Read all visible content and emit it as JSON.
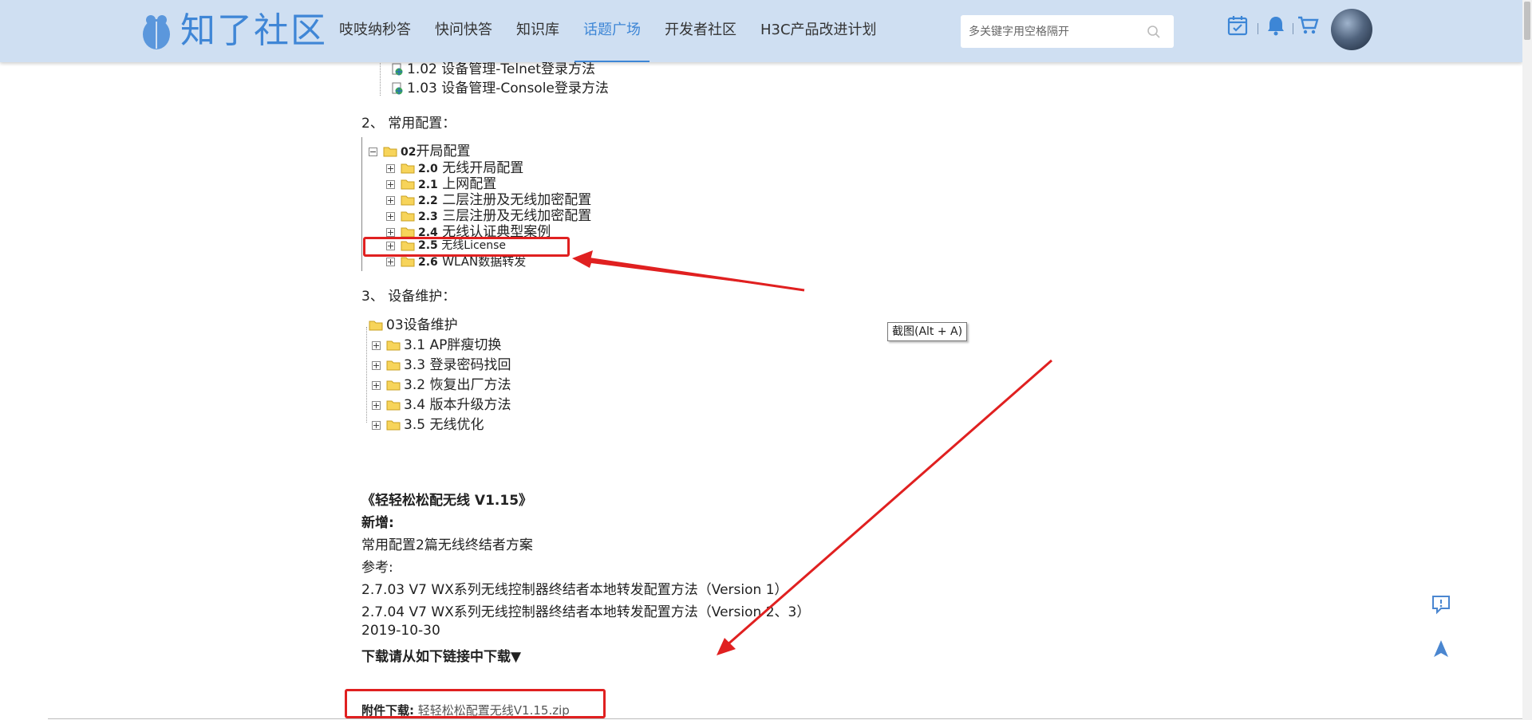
{
  "header": {
    "logo_text": "知了社区",
    "nav": [
      {
        "label": "吱吱纳秒答",
        "active": false
      },
      {
        "label": "快问快答",
        "active": false
      },
      {
        "label": "知识库",
        "active": false
      },
      {
        "label": "话题广场",
        "active": true
      },
      {
        "label": "开发者社区",
        "active": false
      },
      {
        "label": "H3C产品改进计划",
        "active": false
      }
    ],
    "search_placeholder": "多关键字用空格隔开",
    "icons": [
      "calendar-check-icon",
      "bell-icon",
      "cart-icon"
    ]
  },
  "tree1": [
    {
      "num": "1.02",
      "label": "设备管理-Telnet登录方法"
    },
    {
      "num": "1.03",
      "label": "设备管理-Console登录方法"
    }
  ],
  "section2": {
    "heading": "2、 常用配置：",
    "root": {
      "num": "02",
      "label": "开局配置"
    },
    "items": [
      {
        "num": "2.0",
        "label": "无线开局配置"
      },
      {
        "num": "2.1",
        "label": "上网配置"
      },
      {
        "num": "2.2",
        "label": "二层注册及无线加密配置"
      },
      {
        "num": "2.3",
        "label": "三层注册及无线加密配置"
      },
      {
        "num": "2.4",
        "label": "无线认证典型案例"
      },
      {
        "num": "2.5",
        "label": "无线License"
      },
      {
        "num": "2.6",
        "label": "WLAN数据转发"
      }
    ]
  },
  "section3": {
    "heading": "3、 设备维护：",
    "root": {
      "label": "03设备维护"
    },
    "items": [
      {
        "label": "3.1 AP胖瘦切换"
      },
      {
        "label": "3.3 登录密码找回"
      },
      {
        "label": "3.2 恢复出厂方法"
      },
      {
        "label": "3.4 版本升级方法"
      },
      {
        "label": "3.5 无线优化"
      }
    ]
  },
  "tooltip": "截图(Alt + A)",
  "release": {
    "title": "《轻轻松松配无线 V1.15》",
    "new_label": "新增:",
    "line1": "常用配置2篇无线终结者方案",
    "ref_label": "参考:",
    "ref1": "2.7.03  V7 WX系列无线控制器终结者本地转发配置方法（Version 1）",
    "ref2": "2.7.04  V7 WX系列无线控制器终结者本地转发配置方法（Version 2、3）",
    "date": "2019-10-30",
    "download_hint": "下载请从如下链接中下载▼"
  },
  "attachment": {
    "label": "附件下载:",
    "file": "轻轻松松配置无线V1.15.zip"
  },
  "colors": {
    "header_bg": "#cfdff2",
    "accent": "#3d86d6",
    "annotation_red": "#e02020"
  }
}
